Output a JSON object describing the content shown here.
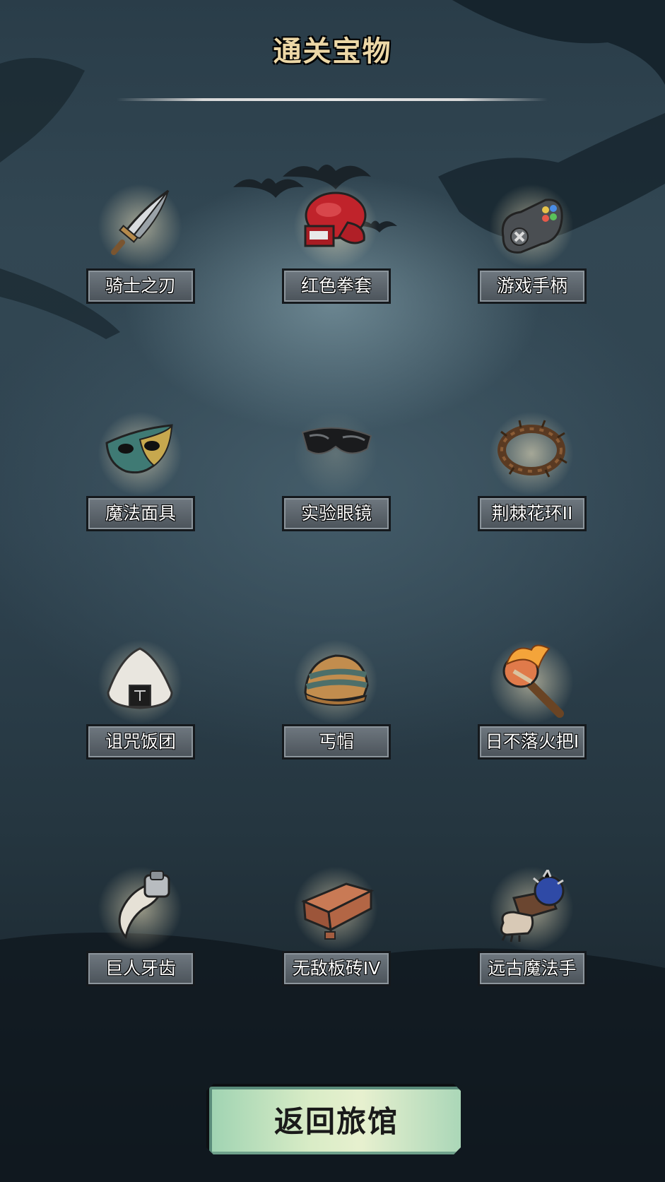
{
  "title": "通关宝物",
  "items": [
    {
      "label": "骑士之刃",
      "icon": "knight-blade-icon"
    },
    {
      "label": "红色拳套",
      "icon": "red-boxing-glove-icon"
    },
    {
      "label": "游戏手柄",
      "icon": "game-controller-icon"
    },
    {
      "label": "魔法面具",
      "icon": "magic-mask-icon"
    },
    {
      "label": "实验眼镜",
      "icon": "lab-goggles-icon"
    },
    {
      "label": "荆棘花环II",
      "icon": "thorn-wreath-icon"
    },
    {
      "label": "诅咒饭团",
      "icon": "cursed-rice-ball-icon"
    },
    {
      "label": "丐帽",
      "icon": "beggar-hat-icon"
    },
    {
      "label": "日不落火把I",
      "icon": "torch-icon"
    },
    {
      "label": "巨人牙齿",
      "icon": "giant-tooth-icon"
    },
    {
      "label": "无敌板砖IV",
      "icon": "brick-icon"
    },
    {
      "label": "远古魔法手",
      "icon": "ancient-magic-hand-icon"
    }
  ],
  "back_button": "返回旅馆"
}
